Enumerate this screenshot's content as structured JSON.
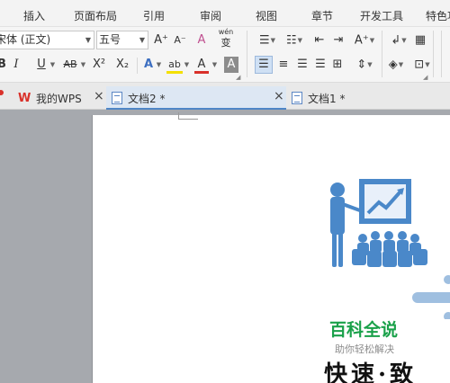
{
  "menu": [
    "插入",
    "页面布局",
    "引用",
    "审阅",
    "视图",
    "章节",
    "开发工具",
    "特色功"
  ],
  "ribbon": {
    "font_name": "宋体 (正文)",
    "font_size": "五号",
    "grow_font": "A⁺",
    "shrink_font": "A⁻",
    "clear_format": "A",
    "pinyin": "wén",
    "pinyin_char": "变",
    "bold": "B",
    "italic": "I",
    "underline": "U",
    "strikethrough": "AB",
    "superscript": "X²",
    "subscript": "X₂",
    "text_effect": "A",
    "highlight": "ab",
    "font_color": "A",
    "char_shading": "A"
  },
  "tabs": [
    {
      "label": "我的WPS",
      "active": false
    },
    {
      "label": "文档2 *",
      "active": true
    },
    {
      "label": "文档1 *",
      "active": false
    }
  ],
  "document": {
    "brand_title": "百科全说",
    "brand_subtitle": "助你轻松解决",
    "watermark": "快速·致"
  },
  "colors": {
    "accent": "#4f86c6",
    "illustration_blue": "#4a88c9",
    "brand_green": "#1aa14a",
    "wps_red": "#d9312a"
  },
  "icons": [
    "bullets-icon",
    "numbering-icon",
    "indent-decrease-icon",
    "indent-increase-icon",
    "sort-icon",
    "table-icon",
    "align-left-icon",
    "align-center-icon",
    "align-right-icon",
    "justify-icon",
    "distribute-icon",
    "line-spacing-icon",
    "shading-icon",
    "border-icon"
  ]
}
